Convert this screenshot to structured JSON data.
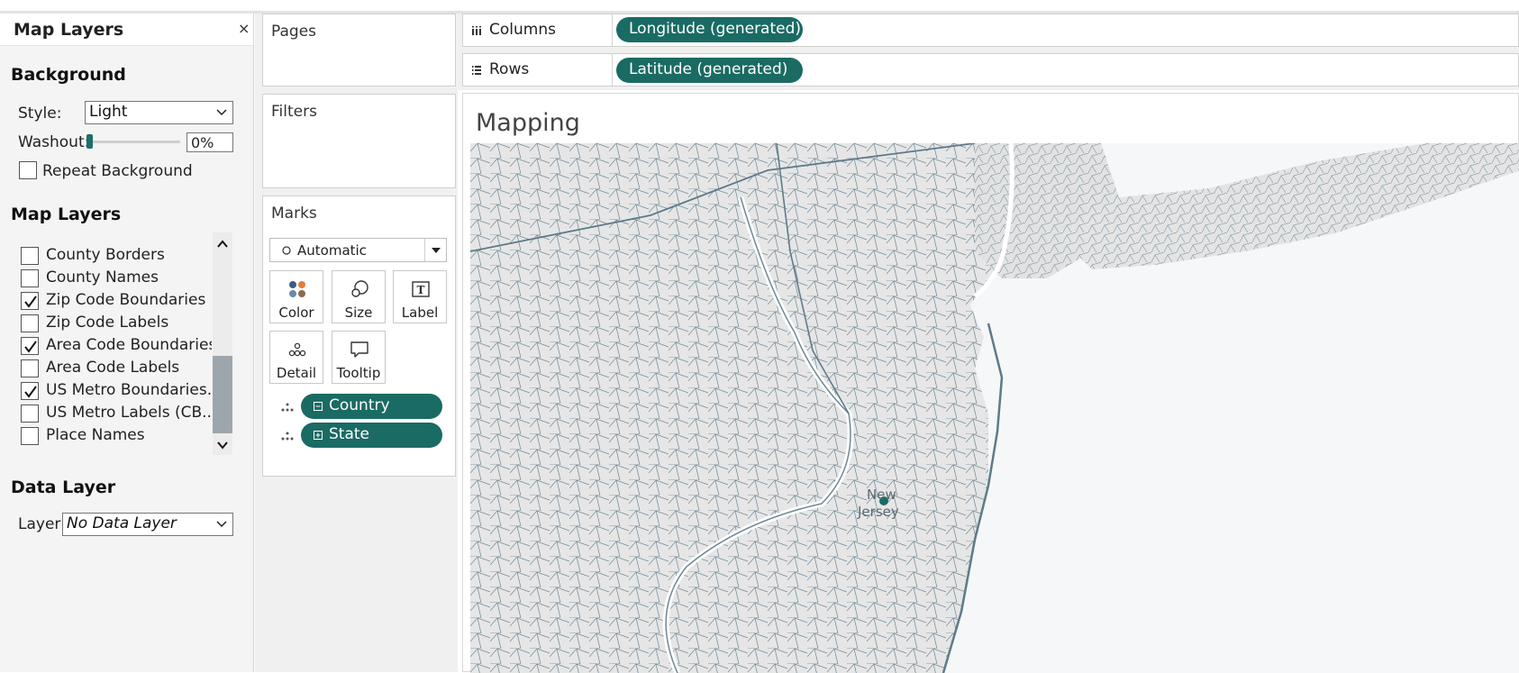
{
  "map_layers_pane": {
    "title": "Map Layers",
    "close_glyph": "×",
    "background": {
      "section_title": "Background",
      "style_label": "Style:",
      "style_value": "Light",
      "washout_label": "Washout:",
      "washout_level_percent": 0,
      "washout_value": "0%",
      "repeat_label": "Repeat Background",
      "repeat_checked": false
    },
    "layers_section_title": "Map Layers",
    "layers": [
      {
        "label": "County Borders",
        "checked": false
      },
      {
        "label": "County Names",
        "checked": false
      },
      {
        "label": "Zip Code Boundaries",
        "checked": true
      },
      {
        "label": "Zip Code Labels",
        "checked": false
      },
      {
        "label": "Area Code Boundaries",
        "checked": true
      },
      {
        "label": "Area Code Labels",
        "checked": false
      },
      {
        "label": "US Metro Boundaries...",
        "checked": true
      },
      {
        "label": "US Metro Labels (CB...",
        "checked": false
      },
      {
        "label": "Place Names",
        "checked": false
      }
    ],
    "data_layer": {
      "section_title": "Data Layer",
      "layer_label": "Layer:",
      "layer_value": "No Data Layer"
    }
  },
  "shelves": {
    "pages_title": "Pages",
    "filters_title": "Filters",
    "marks": {
      "title": "Marks",
      "mark_type": "Automatic",
      "buttons": [
        {
          "label": "Color",
          "icon": "color-dots-icon"
        },
        {
          "label": "Size",
          "icon": "size-circles-icon"
        },
        {
          "label": "Label",
          "icon": "label-t-icon"
        },
        {
          "label": "Detail",
          "icon": "detail-dots-icon"
        },
        {
          "label": "Tooltip",
          "icon": "tooltip-bubble-icon"
        }
      ],
      "fields": [
        {
          "label": "Country",
          "expand_glyph": "minus"
        },
        {
          "label": "State",
          "expand_glyph": "plus"
        }
      ]
    },
    "columns_label": "Columns",
    "columns_pill": "Longitude (generated)",
    "rows_label": "Rows",
    "rows_pill": "Latitude (generated)"
  },
  "view": {
    "title": "Mapping",
    "map_label_line1": "New",
    "map_label_line2": "Jersey"
  },
  "colors": {
    "accent_pill": "#1a6b64",
    "map_boundary": "#6f8a99",
    "map_background": "#e9e9e9"
  }
}
